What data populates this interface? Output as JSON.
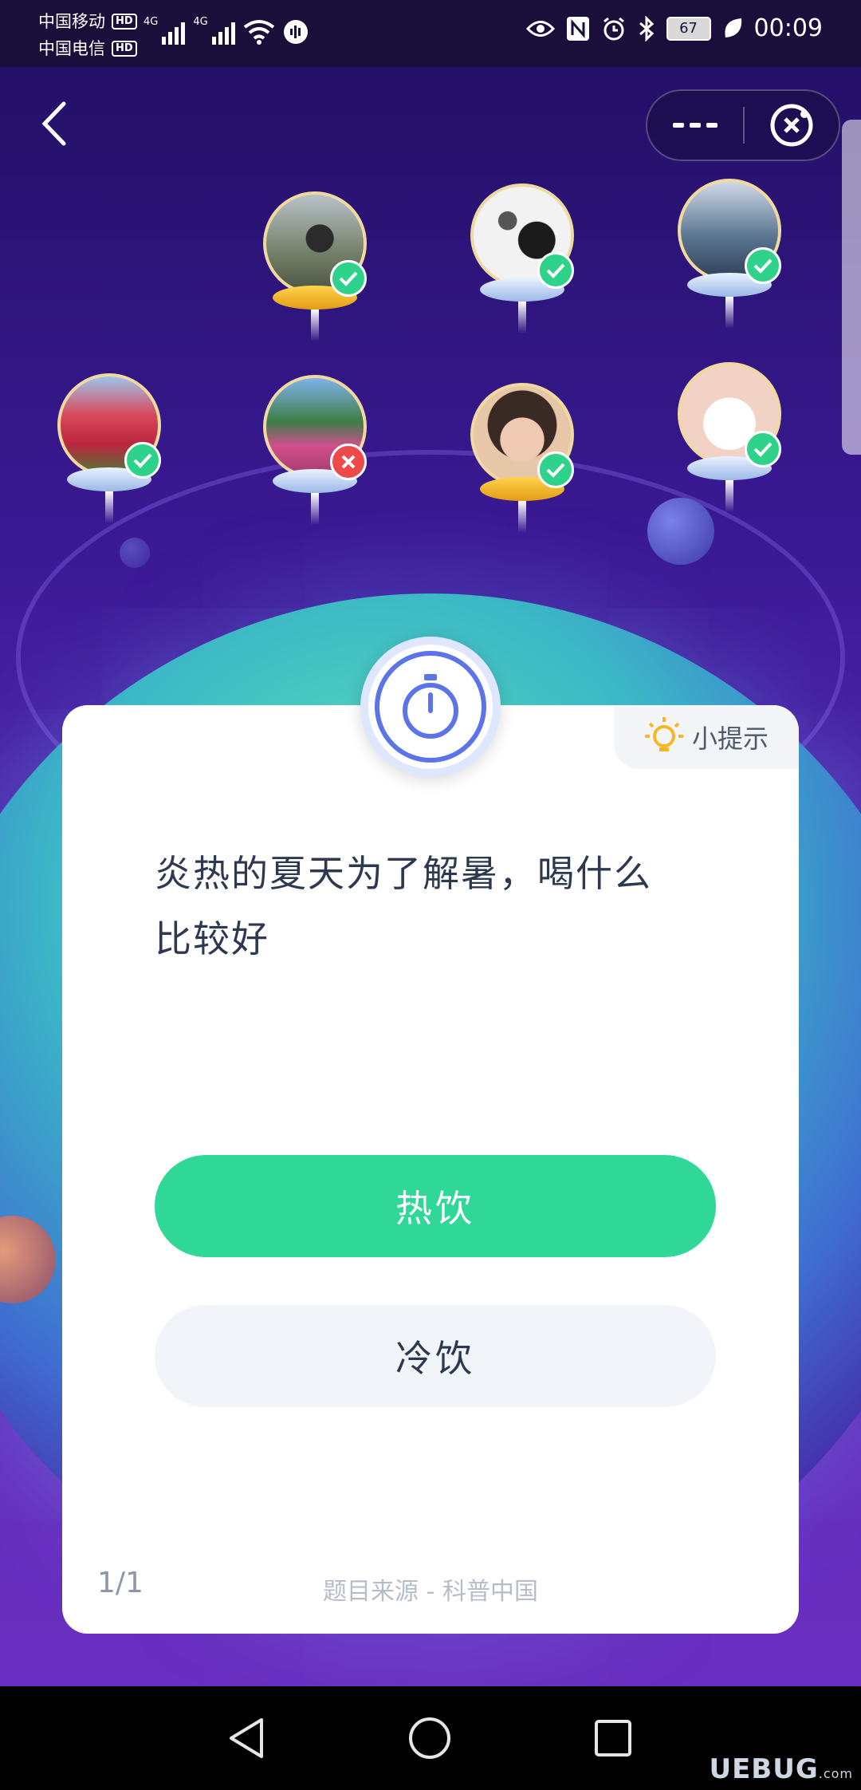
{
  "status_bar": {
    "carrier_1": "中国移动",
    "carrier_2": "中国电信",
    "hd": "HD",
    "network_1": "4G",
    "network_2": "4G",
    "battery": "67",
    "time": "00:09"
  },
  "header": {
    "back_icon": "chevron-left-icon",
    "more_icon": "ellipsis-icon",
    "close_icon": "target-close-icon"
  },
  "players": [
    {
      "status": "correct",
      "badge": "gold"
    },
    {
      "status": "correct",
      "badge": "silver"
    },
    {
      "status": "correct",
      "badge": "silver"
    },
    {
      "status": "correct",
      "badge": "silver"
    },
    {
      "status": "wrong",
      "badge": "silver"
    },
    {
      "status": "correct",
      "badge": "gold"
    },
    {
      "status": "correct",
      "badge": "silver"
    }
  ],
  "question_card": {
    "hint_label": "小提示",
    "question_line_1": "炎热的夏天为了解暑，喝什么",
    "question_line_2": "比较好",
    "option_1": "热饮",
    "option_2": "冷饮",
    "progress": "1/1",
    "source": "题目来源 - 科普中国"
  },
  "watermark": {
    "text": "UEBUG",
    "suffix": ".com"
  },
  "colors": {
    "accent_green": "#2fd896",
    "timer_blue": "#5b74e8",
    "wrong_red": "#ef4a4a"
  }
}
